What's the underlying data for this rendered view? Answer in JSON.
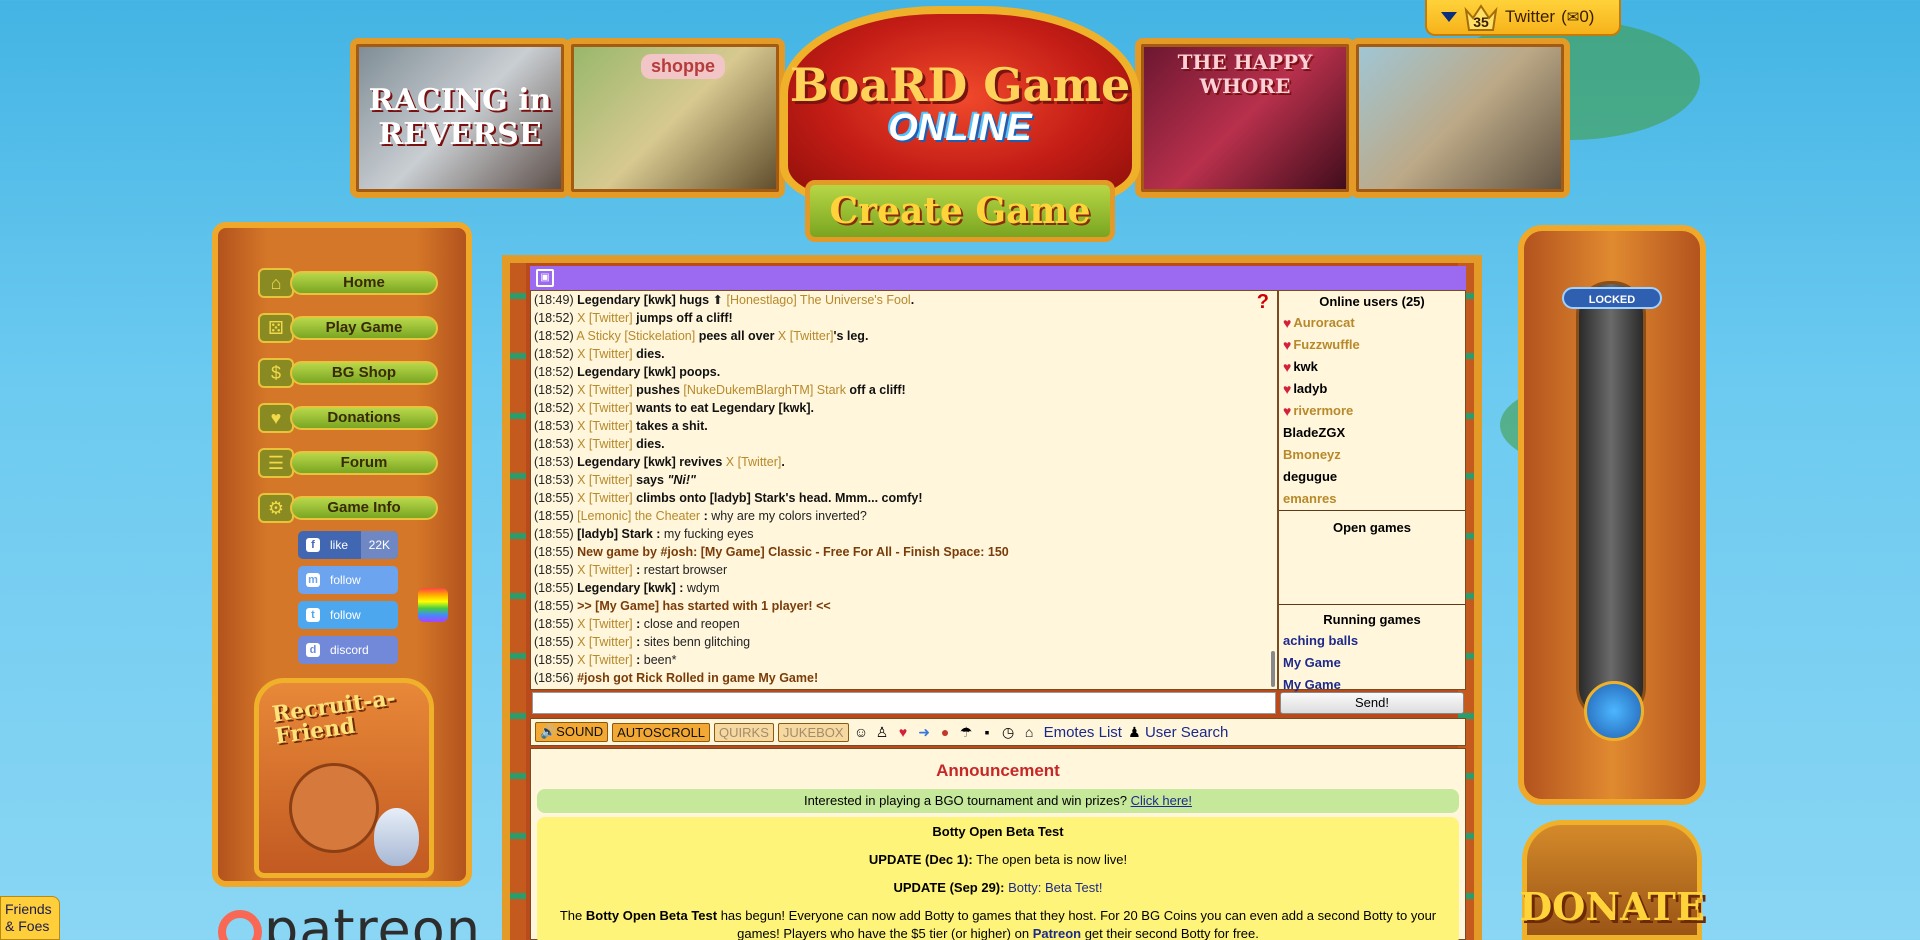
{
  "userbar": {
    "level": "35",
    "username": "Twitter",
    "messages_prefix": "(",
    "messages_count": "0)"
  },
  "banners": {
    "racing": "RACING in REVERSE",
    "shoppe": "shoppe",
    "happy": "THE HAPPY WHORE"
  },
  "logo": {
    "line1": "BoaRD Game",
    "line2": "ONLINE"
  },
  "create_game": "Create Game",
  "nav": {
    "home": "Home",
    "play": "Play Game",
    "shop": "BG Shop",
    "donations": "Donations",
    "forum": "Forum",
    "gameinfo": "Game Info"
  },
  "social": {
    "fb_label": "like",
    "fb_count": "22K",
    "mastodon": "follow",
    "twitter": "follow",
    "discord": "discord"
  },
  "recruit": "Recruit-a-Friend",
  "patreon": "patreon",
  "friends": {
    "line1": "Friends",
    "line2": "& Foes"
  },
  "chat": [
    {
      "t": "(18:49)",
      "parts": [
        [
          "b",
          "Legendary [kwk]"
        ],
        [
          "b",
          " hugs "
        ],
        [
          "n",
          "⬆ "
        ],
        [
          "u1",
          "[Honestlago] The Universe's Fool"
        ],
        [
          "b",
          "."
        ]
      ]
    },
    {
      "t": "(18:52)",
      "parts": [
        [
          "u1",
          "X [Twitter]"
        ],
        [
          "b",
          " jumps off a cliff!"
        ]
      ]
    },
    {
      "t": "(18:52)",
      "parts": [
        [
          "u1",
          "A Sticky [Stickelation]"
        ],
        [
          "b",
          " pees all over "
        ],
        [
          "u1",
          "X [Twitter]"
        ],
        [
          "b",
          "'s leg."
        ]
      ]
    },
    {
      "t": "(18:52)",
      "parts": [
        [
          "u1",
          "X [Twitter]"
        ],
        [
          "b",
          " dies."
        ]
      ]
    },
    {
      "t": "(18:52)",
      "parts": [
        [
          "b",
          "Legendary [kwk] poops."
        ]
      ]
    },
    {
      "t": "(18:52)",
      "parts": [
        [
          "u1",
          "X [Twitter]"
        ],
        [
          "b",
          " pushes "
        ],
        [
          "u1",
          "[NukeDukemBlarghTM] Stark"
        ],
        [
          "b",
          " off a cliff!"
        ]
      ]
    },
    {
      "t": "(18:52)",
      "parts": [
        [
          "u1",
          "X [Twitter]"
        ],
        [
          "b",
          " wants to eat Legendary [kwk]."
        ]
      ]
    },
    {
      "t": "(18:53)",
      "parts": [
        [
          "u1",
          "X [Twitter]"
        ],
        [
          "b",
          " takes a shit."
        ]
      ]
    },
    {
      "t": "(18:53)",
      "parts": [
        [
          "u1",
          "X [Twitter]"
        ],
        [
          "b",
          " dies."
        ]
      ]
    },
    {
      "t": "(18:53)",
      "parts": [
        [
          "b",
          "Legendary [kwk] revives "
        ],
        [
          "u1",
          "X [Twitter]"
        ],
        [
          "b",
          "."
        ]
      ]
    },
    {
      "t": "(18:53)",
      "parts": [
        [
          "u1",
          "X [Twitter]"
        ],
        [
          "b",
          " says "
        ],
        [
          "b",
          "\"Ni!\""
        ]
      ]
    },
    {
      "t": "(18:55)",
      "parts": [
        [
          "u1",
          "X [Twitter]"
        ],
        [
          "b",
          " climbs onto [ladyb] Stark's head. Mmm... comfy!"
        ]
      ]
    },
    {
      "t": "(18:55)",
      "parts": [
        [
          "u1",
          "[Lemonic] the Cheater"
        ],
        [
          "b",
          " : "
        ],
        [
          "n",
          "why are my colors inverted?"
        ]
      ]
    },
    {
      "t": "(18:55)",
      "parts": [
        [
          "b",
          "[ladyb] Stark : "
        ],
        [
          "n",
          "my fucking eyes"
        ]
      ]
    },
    {
      "t": "(18:55)",
      "parts": [
        [
          "ng",
          "New game by #josh: "
        ],
        [
          "ng",
          "[My Game]"
        ],
        [
          "ng",
          " Classic - Free For All - Finish Space: 150"
        ]
      ]
    },
    {
      "t": "(18:55)",
      "parts": [
        [
          "u1",
          "X [Twitter]"
        ],
        [
          "b",
          " : "
        ],
        [
          "n",
          "restart browser"
        ]
      ]
    },
    {
      "t": "(18:55)",
      "parts": [
        [
          "b",
          "Legendary [kwk] : "
        ],
        [
          "n",
          "wdym"
        ]
      ]
    },
    {
      "t": "(18:55)",
      "parts": [
        [
          "ng",
          ">> [My Game] has started with 1 player! <<"
        ]
      ]
    },
    {
      "t": "(18:55)",
      "parts": [
        [
          "u1",
          "X [Twitter]"
        ],
        [
          "b",
          " : "
        ],
        [
          "n",
          "close and reopen"
        ]
      ]
    },
    {
      "t": "(18:55)",
      "parts": [
        [
          "u1",
          "X [Twitter]"
        ],
        [
          "b",
          " : "
        ],
        [
          "n",
          "sites benn glitching"
        ]
      ]
    },
    {
      "t": "(18:55)",
      "parts": [
        [
          "u1",
          "X [Twitter]"
        ],
        [
          "b",
          " : "
        ],
        [
          "n",
          "been*"
        ]
      ]
    },
    {
      "t": "(18:56)",
      "parts": [
        [
          "ng",
          "#josh got Rick Rolled in game My Game!"
        ]
      ]
    }
  ],
  "online": {
    "header": "Online users (25)",
    "users": [
      {
        "name": "Auroracat",
        "heart": true,
        "gold": true
      },
      {
        "name": "Fuzzwuffle",
        "heart": true,
        "gold": true
      },
      {
        "name": "kwk",
        "heart": true,
        "gold": false
      },
      {
        "name": "ladyb",
        "heart": true,
        "gold": false
      },
      {
        "name": "rivermore",
        "heart": true,
        "gold": true
      },
      {
        "name": "BladeZGX",
        "heart": false,
        "gold": false
      },
      {
        "name": "Bmoneyz",
        "heart": false,
        "gold": true
      },
      {
        "name": "degugue",
        "heart": false,
        "gold": false
      },
      {
        "name": "emanres",
        "heart": false,
        "gold": true
      }
    ],
    "open_games": "Open games",
    "running_games": "Running games",
    "running": [
      "aching balls",
      "My Game",
      "My Game"
    ]
  },
  "send": "Send!",
  "toolbar": {
    "sound": "🔊SOUND",
    "autoscroll": "AUTOSCROLL",
    "quirks": "QUIRKS",
    "jukebox": "JUKEBOX",
    "emotes_list": "Emotes List",
    "user_search": "User Search"
  },
  "announcement": {
    "title": "Announcement",
    "tournament_text": "Interested in playing a BGO tournament and win prizes?",
    "tournament_link": "Click here!",
    "beta_title": "Botty Open Beta Test",
    "update1_label": "UPDATE (Dec 1):",
    "update1_text": "The open beta is now live!",
    "update2_label": "UPDATE (Sep 29):",
    "update2_link": "Botty: Beta Test!",
    "body_a": "The ",
    "body_b": "Botty Open Beta Test",
    "body_c": " has begun! Everyone can now add Botty to games that they host. For 20 BG Coins you can even add a second Botty to your games! Players who have the $5 tier (or higher) on ",
    "body_patreon": "Patreon",
    "body_d": " get their second Botty for free."
  },
  "right": {
    "locked": "LOCKED",
    "donate": "DONATE"
  }
}
